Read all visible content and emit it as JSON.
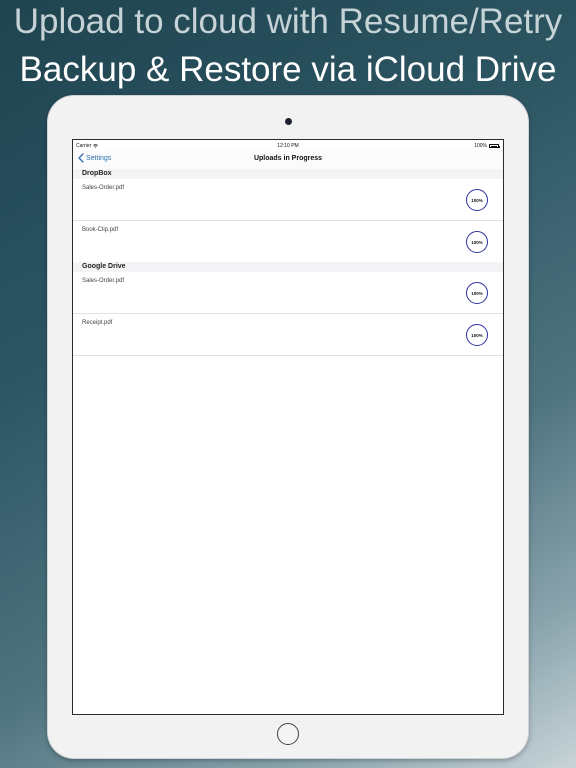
{
  "headlines": {
    "line1": "Upload to cloud with Resume/Retry",
    "line2": "Backup & Restore via iCloud Drive"
  },
  "status_bar": {
    "carrier": "Carrier",
    "time": "12:10 PM",
    "battery": "100%"
  },
  "nav": {
    "back_label": "Settings",
    "title": "Uploads in Progress"
  },
  "sections": [
    {
      "header": "DropBox",
      "items": [
        {
          "file": "Sales-Order.pdf",
          "progress": "100%"
        },
        {
          "file": "Book-Clip.pdf",
          "progress": "100%"
        }
      ]
    },
    {
      "header": "Google Drive",
      "items": [
        {
          "file": "Sales-Order.pdf",
          "progress": "100%"
        },
        {
          "file": "Receipt.pdf",
          "progress": "100%"
        }
      ]
    }
  ],
  "icons": {
    "back": "chevron-left-icon",
    "wifi": "wifi-icon",
    "battery": "battery-icon",
    "camera": "camera",
    "home": "home-button"
  },
  "colors": {
    "accent": "#2d6fb0",
    "progress_ring": "#2c2fa0"
  }
}
